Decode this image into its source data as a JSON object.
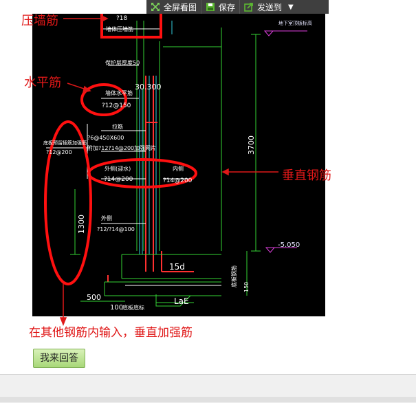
{
  "toolbar": {
    "fullscreen_label": "全屏看图",
    "save_label": "保存",
    "send_label": "发送到"
  },
  "annotations": {
    "compression_bar": "压墙筋",
    "horizontal_bar": "水平筋",
    "vertical_bar": "垂直钢筋",
    "note": "在其他钢筋内输入，垂直加强筋"
  },
  "drawing": {
    "top_rebar": "?18",
    "top_rebar_sub": "墙体压墙筋",
    "protect_layer": "保护层厚度50",
    "elevation_top": "30.300",
    "horizontal_label": "墙体水平筋",
    "horizontal_spec": "?12@150",
    "tie_label": "拉筋",
    "tie_spec": "?6@450X600",
    "extra_spec": "附加?12?14@200加强网片",
    "left_label": "底板预留插筋加强筋",
    "left_spec": "?12@200",
    "outer_label": "外侧(迎水)",
    "outer_spec": "?14@200",
    "inner_label": "内侧",
    "inner_spec": "?14@200",
    "outer2_label": "外侧",
    "outer2_spec": "?12/?14@100",
    "height_3700": "3700",
    "height_1300": "1300",
    "elevation_bottom": "-5.050",
    "level_top_note": "地下室顶板标高",
    "dim_15d": "15d",
    "dim_lae": "LaE",
    "dim_500": "500",
    "dim_100": "100",
    "base_note": "底板底标",
    "bottom_slab": "底板钢筋",
    "dim_150": "150"
  },
  "answer_button": "我来回答"
}
